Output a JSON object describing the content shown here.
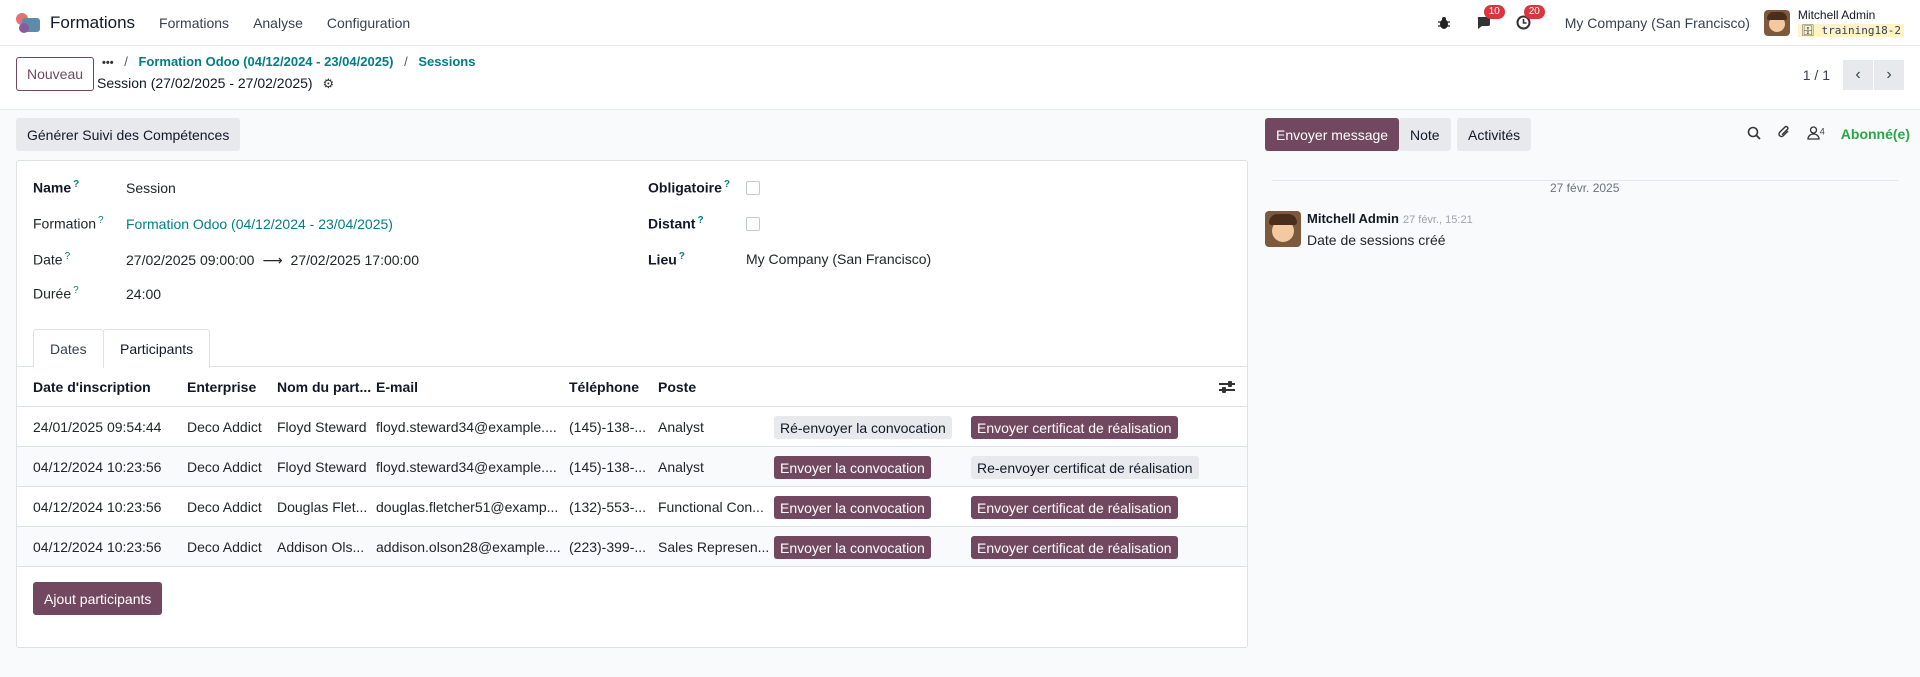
{
  "navbar": {
    "app_name": "Formations",
    "menu": [
      "Formations",
      "Analyse",
      "Configuration"
    ],
    "messages_count": "10",
    "activities_count": "20",
    "company": "My Company (San Francisco)",
    "user_name": "Mitchell Admin",
    "database": "training18-2"
  },
  "control_panel": {
    "new_button": "Nouveau",
    "breadcrumb_more": "•••",
    "breadcrumb_sep": "/",
    "breadcrumb_1": "Formation Odoo (04/12/2024 - 23/04/2025)",
    "breadcrumb_2": "Sessions",
    "record_title": "Session (27/02/2025 - 27/02/2025)",
    "pager": "1 / 1"
  },
  "statusbar": {
    "generate_button": "Générer Suivi des Compétences"
  },
  "form": {
    "help_mark": "?",
    "name_label": "Name",
    "name_value": "Session",
    "formation_label": "Formation",
    "formation_value": "Formation Odoo (04/12/2024 - 23/04/2025)",
    "date_label": "Date",
    "date_start": "27/02/2025 09:00:00",
    "date_end": "27/02/2025 17:00:00",
    "duration_label": "Durée",
    "duration_value": "24:00",
    "mandatory_label": "Obligatoire",
    "remote_label": "Distant",
    "place_label": "Lieu",
    "place_value": "My Company (San Francisco)"
  },
  "tabs": [
    "Dates",
    "Participants"
  ],
  "table": {
    "headers": [
      "Date d'inscription",
      "Enterprise",
      "Nom du part...",
      "E-mail",
      "Téléphone",
      "Poste"
    ],
    "rows": [
      {
        "date": "24/01/2025 09:54:44",
        "enterprise": "Deco Addict",
        "name": "Floyd Steward",
        "email": "floyd.steward34@example....",
        "phone": "(145)-138-...",
        "job": "Analyst",
        "btn1": "Ré-envoyer la convocation",
        "btn1_primary": false,
        "btn2": "Envoyer certificat de réalisation",
        "btn2_primary": true
      },
      {
        "date": "04/12/2024 10:23:56",
        "enterprise": "Deco Addict",
        "name": "Floyd Steward",
        "email": "floyd.steward34@example....",
        "phone": "(145)-138-...",
        "job": "Analyst",
        "btn1": "Envoyer la convocation",
        "btn1_primary": true,
        "btn2": "Re-envoyer certificat de réalisation",
        "btn2_primary": false
      },
      {
        "date": "04/12/2024 10:23:56",
        "enterprise": "Deco Addict",
        "name": "Douglas Flet...",
        "email": "douglas.fletcher51@examp...",
        "phone": "(132)-553-...",
        "job": "Functional Con...",
        "btn1": "Envoyer la convocation",
        "btn1_primary": true,
        "btn2": "Envoyer certificat de réalisation",
        "btn2_primary": true
      },
      {
        "date": "04/12/2024 10:23:56",
        "enterprise": "Deco Addict",
        "name": "Addison Ols...",
        "email": "addison.olson28@example....",
        "phone": "(223)-399-...",
        "job": "Sales Represen...",
        "btn1": "Envoyer la convocation",
        "btn1_primary": true,
        "btn2": "Envoyer certificat de réalisation",
        "btn2_primary": true
      }
    ],
    "add_button": "Ajout participants"
  },
  "chatter": {
    "send_message": "Envoyer message",
    "note": "Note",
    "activities": "Activités",
    "followers_count": "4",
    "follow_state": "Abonné(e)",
    "date_separator": "27 févr. 2025",
    "message_author": "Mitchell Admin",
    "message_time": "27 févr., 15:21",
    "message_body": "Date de sessions créé"
  },
  "colors": {
    "primary": "#71485f",
    "link": "#017e84",
    "badge": "#d9363e",
    "follow": "#28a745"
  }
}
